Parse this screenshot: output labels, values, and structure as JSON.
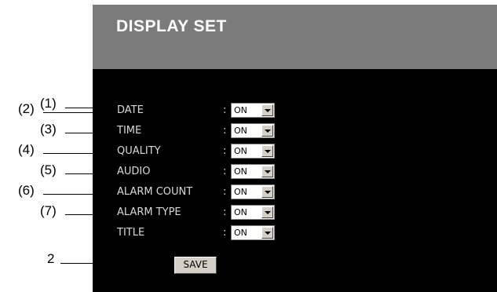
{
  "header": {
    "title": "DISPLAY SET"
  },
  "settings": [
    {
      "callout": "(1)",
      "label": "DATE",
      "colon": ":",
      "value": "ON"
    },
    {
      "callout": "(2)",
      "label": "TIME",
      "colon": ":",
      "value": "ON"
    },
    {
      "callout": "(3)",
      "label": "QUALITY",
      "colon": ":",
      "value": "ON"
    },
    {
      "callout": "(4)",
      "label": "AUDIO",
      "colon": ":",
      "value": "ON"
    },
    {
      "callout": "(5)",
      "label": "ALARM COUNT",
      "colon": ":",
      "value": "ON"
    },
    {
      "callout": "(6)",
      "label": "ALARM TYPE",
      "colon": ":",
      "value": "ON"
    },
    {
      "callout": "(7)",
      "label": "TITLE",
      "colon": ":",
      "value": "ON"
    }
  ],
  "save": {
    "label": "SAVE",
    "callout": "2"
  },
  "colors": {
    "header_bg": "#7b7b7b",
    "screen_bg": "#000000",
    "label_text": "#d8d8d8"
  }
}
